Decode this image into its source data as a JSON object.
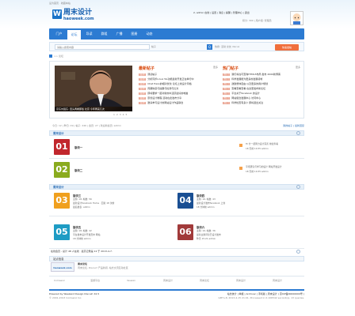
{
  "topbar": {
    "left": "设为首页 · 收藏本站",
    "right": ""
  },
  "logo": {
    "cn": "周末设计",
    "en": "haoweek.com",
    "mark": "W"
  },
  "user": {
    "line1": "2, admin 在线 | 设置 | 消息 | 提醒 | 管理中心 | 退出",
    "line2": "积分: 300 | 用户组: 管理员"
  },
  "nav": [
    "门户",
    "论坛",
    "导读",
    "群组",
    "广播",
    "图册",
    "动态"
  ],
  "nav_active": 1,
  "search": {
    "placeholder": "请输入搜索内容",
    "button": "Q",
    "hot": "热搜: 活动 交友 discuz",
    "scope": "帖子"
  },
  "post_button": "快速发帖",
  "breadcrumb": ">> 论坛",
  "feature": {
    "photo_caption": "京东刘强东: 回头再看那些 北京 今年再来几次",
    "dots": "1 2 3 4 5",
    "latest_title": "最新帖子",
    "latest_more": "更多",
    "hot_title": "热门帖子",
    "hot_more": "更多",
    "latest": [
      {
        "tag": "[最新]",
        "text": "测试帖子"
      },
      {
        "tag": "[最新]",
        "text": "分析同步Linux 5G功能最新开发正在举行中"
      },
      {
        "tag": "[最新]",
        "text": "Chat Hexo的相对优化 论坛上线设计风格"
      },
      {
        "tag": "[最新]",
        "text": "周期恢复与提醒与检测与比对"
      },
      {
        "tag": "[最新]",
        "text": "即将要求一起对新的中活跃最好的电脑"
      },
      {
        "tag": "[最新]",
        "text": "原创设计教程 活动在此发布分享"
      },
      {
        "tag": "[最新]",
        "text": "邀请参与设计的网站设计作品联合"
      }
    ],
    "hot": [
      {
        "tag": "[热门]",
        "text": "我们将在可查询HTML5布局 发布 2000新博客"
      },
      {
        "tag": "[热门]",
        "text": "科学发展能为更多的发展领域"
      },
      {
        "tag": "[热门]",
        "text": "鼓励整体自由 以及更多的用户规划"
      },
      {
        "tag": "[热门]",
        "text": "查看查看查看 在这里发布新论坛"
      },
      {
        "tag": "[热门]",
        "text": "平台关于facebook 的设计"
      },
      {
        "tag": "[热门]",
        "text": "网站组合发展中心 访问中心"
      },
      {
        "tag": "[热门]",
        "text": "科学检查有多少 即将退出关注"
      }
    ]
  },
  "stats": {
    "text": "今日: 12 | 昨日: 49 | 帖子: 246 | 会员: 27 | 欢迎新会员: admin",
    "right": "我的帖子 | 最新回复"
  },
  "sections": [
    {
      "title": "周末设计"
    },
    {
      "title": "周末设计"
    },
    {
      "title": "站点信息"
    }
  ],
  "forums_a": [
    {
      "num": "01",
      "name": "版块一",
      "meta1": "",
      "meta2": "",
      "last1": "Hi 分一起努力设计完善 前往查看",
      "last2": "18 天前 10:35 admin",
      "color": "#c1272d"
    },
    {
      "num": "02",
      "name": "版块二",
      "meta1": "",
      "meta2": "",
      "last1": "平坦研究与学习的设计 网站开发设计",
      "last2": "18 天前 10:35 admin",
      "color": "#8aab1e"
    }
  ],
  "forums_b": [
    {
      "num": "03",
      "name": "版块三",
      "meta1": "主题: 18, 帖数: 56",
      "meta2": "最新设计facebook Home · 回复 18 次前",
      "last": "最后发表: admin",
      "color": "#f0a01e"
    },
    {
      "num": "04",
      "name": "版块四",
      "meta1": "主题: 16, 帖数: 43",
      "meta2": "最新设计发布facebook 上线",
      "last": "18 分钟前 admin",
      "color": "#1a4f93"
    },
    {
      "num": "05",
      "name": "版块五",
      "meta1": "主题: 18, 帖数: 42",
      "meta2": "平台发布设计开发页中 网站",
      "last": "18 分钟前 admin",
      "color": "#1e9cc4"
    },
    {
      "num": "06",
      "name": "版块六",
      "meta1": "主题: 16, 帖数: 36",
      "meta2": "最新主题评论已设计发布",
      "last": "昨天 15:21 admin",
      "color": "#a13a3a"
    }
  ],
  "siteinfo": "在线会员 - 总计 48 人在线 · 最高记录是 12 于 2013-4-7.",
  "site_logo": "周末论坛",
  "site_desc": "周末论坛, Discuz! 产品新闻, 站长交流互动社区",
  "footer_links": [
    "Comsenz",
    "漫游平台",
    "Yeswan",
    "周末设计",
    "周末论坛",
    "周末设计",
    "周末设计"
  ],
  "footer": {
    "powered": "Powered by Weekend Design Discuz! X2.5",
    "copy": "© 2001-2013 Comsenz Inc.",
    "right": "站长统计 | 举报 | Archiver | 手机版 | 周末设计 ( 京ICP备00000000号 )",
    "gmt": "GMT+8, 2013-4-15 21:01, Processed in 0.106542 second(s), 13 queries."
  }
}
